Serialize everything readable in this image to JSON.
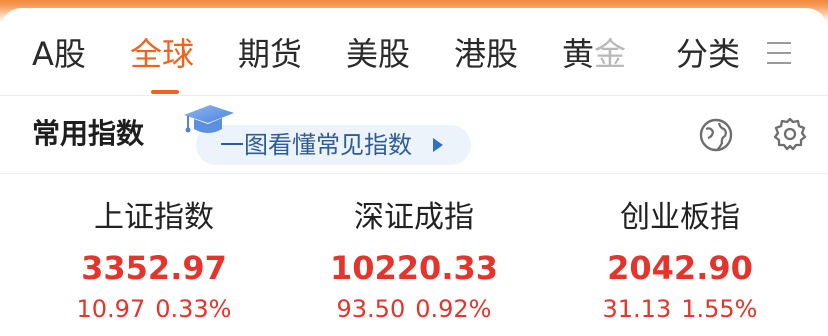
{
  "tabs": [
    {
      "label": "A股",
      "active": false
    },
    {
      "label": "全球",
      "active": true
    },
    {
      "label": "期货",
      "active": false
    },
    {
      "label": "美股",
      "active": false
    },
    {
      "label": "港股",
      "active": false
    },
    {
      "label_a": "黄",
      "label_b": "金",
      "active": false
    },
    {
      "label": "分类",
      "active": false
    }
  ],
  "menu_icon": "hamburger-menu-icon",
  "section": {
    "title": "常用指数",
    "tip_text": "一图看懂常见指数",
    "cap_icon": "graduation-cap-icon",
    "globe_icon": "globe-icon",
    "gear_icon": "gear-icon"
  },
  "indices": [
    {
      "name": "上证指数",
      "value": "3352.97",
      "change": "10.97",
      "percent": "0.33%"
    },
    {
      "name": "深证成指",
      "value": "10220.33",
      "change": "93.50",
      "percent": "0.92%"
    },
    {
      "name": "创业板指",
      "value": "2042.90",
      "change": "31.13",
      "percent": "1.55%"
    }
  ],
  "colors": {
    "accent": "#f0631f",
    "up_red": "#e5342c",
    "tip_blue": "#2e5c96",
    "tip_bg": "#edf3fb"
  }
}
